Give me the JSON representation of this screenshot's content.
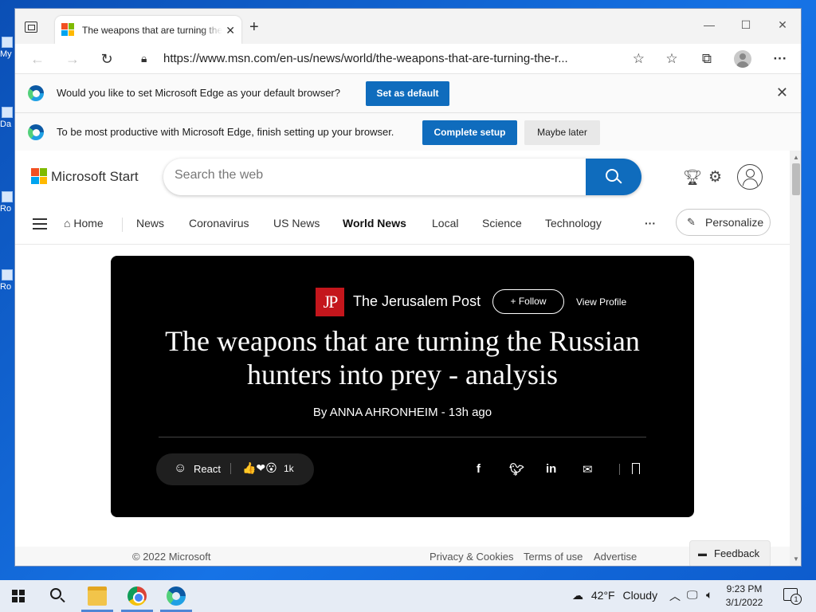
{
  "desktop": {
    "icons": [
      "My",
      "Da",
      "Ro",
      "Ro"
    ]
  },
  "browser": {
    "tab_title": "The weapons that are turning the Russian hunters into prey - analysis",
    "url": "https://www.msn.com/en-us/news/world/the-weapons-that-are-turning-the-r...",
    "infobar_default": {
      "message": "Would you like to set Microsoft Edge as your default browser?",
      "button": "Set as default"
    },
    "infobar_setup": {
      "message": "To be most productive with Microsoft Edge, finish setting up your browser.",
      "primary_button": "Complete setup",
      "secondary_button": "Maybe later"
    }
  },
  "msn": {
    "brand": "Microsoft Start",
    "search_placeholder": "Search the web",
    "nav": [
      "Home",
      "News",
      "Coronavirus",
      "US News",
      "World News",
      "Local",
      "Science",
      "Technology"
    ],
    "more": "···",
    "personalize": "Personalize"
  },
  "article": {
    "publisher": "The Jerusalem Post",
    "publisher_logo": "JP",
    "follow": "Follow",
    "view_profile": "View Profile",
    "headline": "The weapons that are turning the Russian hunters into prey - analysis",
    "byline": "By ANNA AHRONHEIM - 13h ago",
    "react_label": "React",
    "reaction_emojis": "👍❤😮",
    "reaction_count": "1k"
  },
  "footer": {
    "copyright": "© 2022 Microsoft",
    "links": [
      "Privacy & Cookies",
      "Terms of use",
      "Advertise"
    ],
    "feedback": "Feedback"
  },
  "taskbar": {
    "temperature": "42°F",
    "weather": "Cloudy",
    "time": "9:23 PM",
    "date": "3/1/2022",
    "notification_count": "1"
  },
  "colors": {
    "accent": "#0f6cbd",
    "hero_bg": "#000000",
    "jp_red": "#c4161c",
    "desktop_blue": "#1673e6"
  }
}
